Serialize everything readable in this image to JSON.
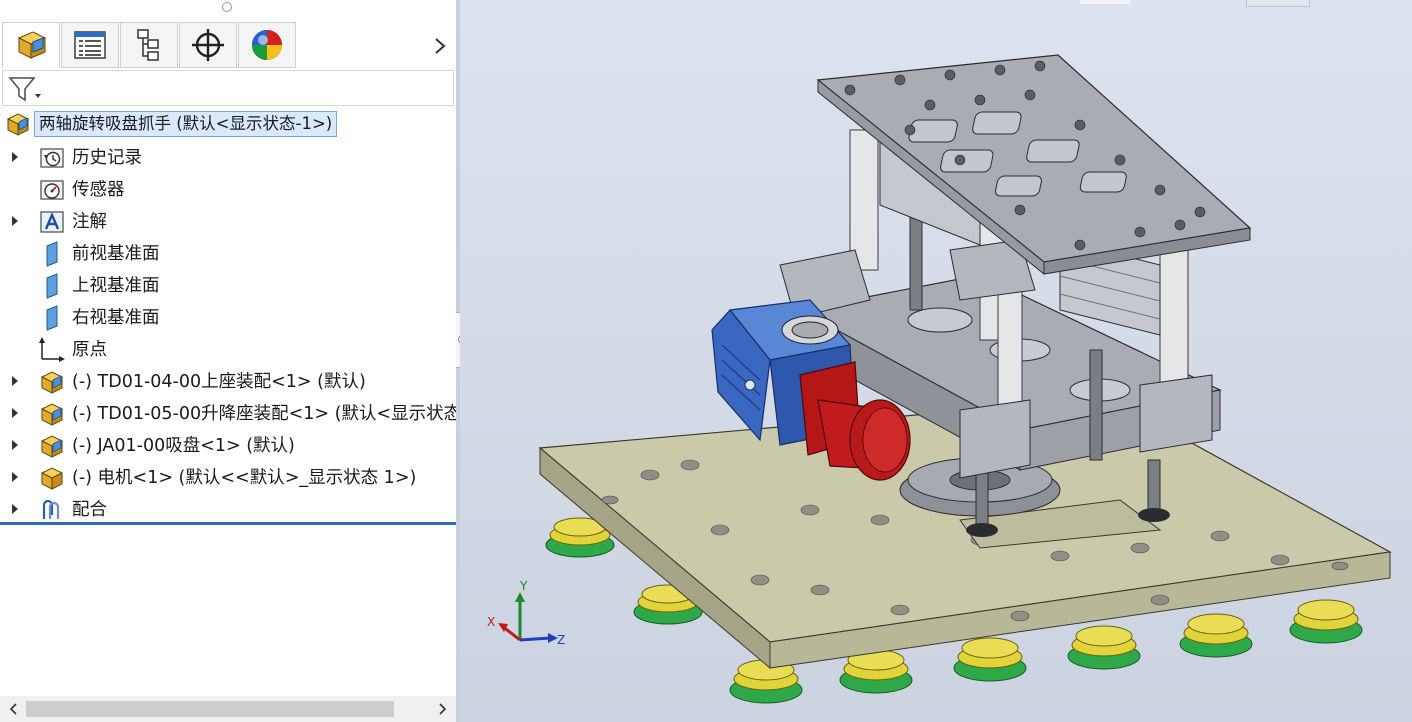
{
  "panel": {
    "tabs": [
      {
        "name": "FeatureManager",
        "icon": "feature-manager-icon"
      },
      {
        "name": "PropertyManager",
        "icon": "property-manager-icon"
      },
      {
        "name": "ConfigurationManager",
        "icon": "configuration-manager-icon"
      },
      {
        "name": "DimXpertManager",
        "icon": "crosshair-icon"
      },
      {
        "name": "DisplayManager",
        "icon": "display-manager-icon"
      }
    ],
    "more_icon": "chevron-right-icon",
    "filter_icon": "filter-icon"
  },
  "tree": {
    "root": {
      "label": "两轴旋转吸盘抓手 (默认<显示状态-1>)",
      "icon": "assembly-icon"
    },
    "items": [
      {
        "label": "历史记录",
        "icon": "history-icon",
        "expandable": true
      },
      {
        "label": "传感器",
        "icon": "sensor-icon",
        "expandable": false
      },
      {
        "label": "注解",
        "icon": "annotation-icon",
        "expandable": true
      },
      {
        "label": "前视基准面",
        "icon": "plane-icon",
        "expandable": false
      },
      {
        "label": "上视基准面",
        "icon": "plane-icon",
        "expandable": false
      },
      {
        "label": "右视基准面",
        "icon": "plane-icon",
        "expandable": false
      },
      {
        "label": "原点",
        "icon": "origin-icon",
        "expandable": false
      },
      {
        "label": "(-) TD01-04-00上座装配<1> (默认)",
        "icon": "subassembly-icon",
        "expandable": true
      },
      {
        "label": "(-) TD01-05-00升降座装配<1> (默认<显示状态",
        "icon": "subassembly-icon",
        "expandable": true
      },
      {
        "label": "(-) JA01-00吸盘<1> (默认)",
        "icon": "subassembly-icon",
        "expandable": true
      },
      {
        "label": "(-) 电机<1> (默认<<默认>_显示状态 1>)",
        "icon": "subassembly-icon",
        "expandable": true
      },
      {
        "label": "配合",
        "icon": "mates-icon",
        "expandable": true
      }
    ]
  },
  "triad": {
    "x_label": "X",
    "y_label": "Y",
    "z_label": "Z"
  },
  "colors": {
    "selection_bg": "#d9e9fb",
    "divider": "#2f6bbf",
    "base_plate": "#c9c8a8",
    "gray_plate": "#a9adb3",
    "gearbox": "#3f6ec6",
    "motor": "#c21b1b",
    "suction_cup_green": "#2fa84a",
    "suction_cup_yellow": "#e1d43a"
  }
}
